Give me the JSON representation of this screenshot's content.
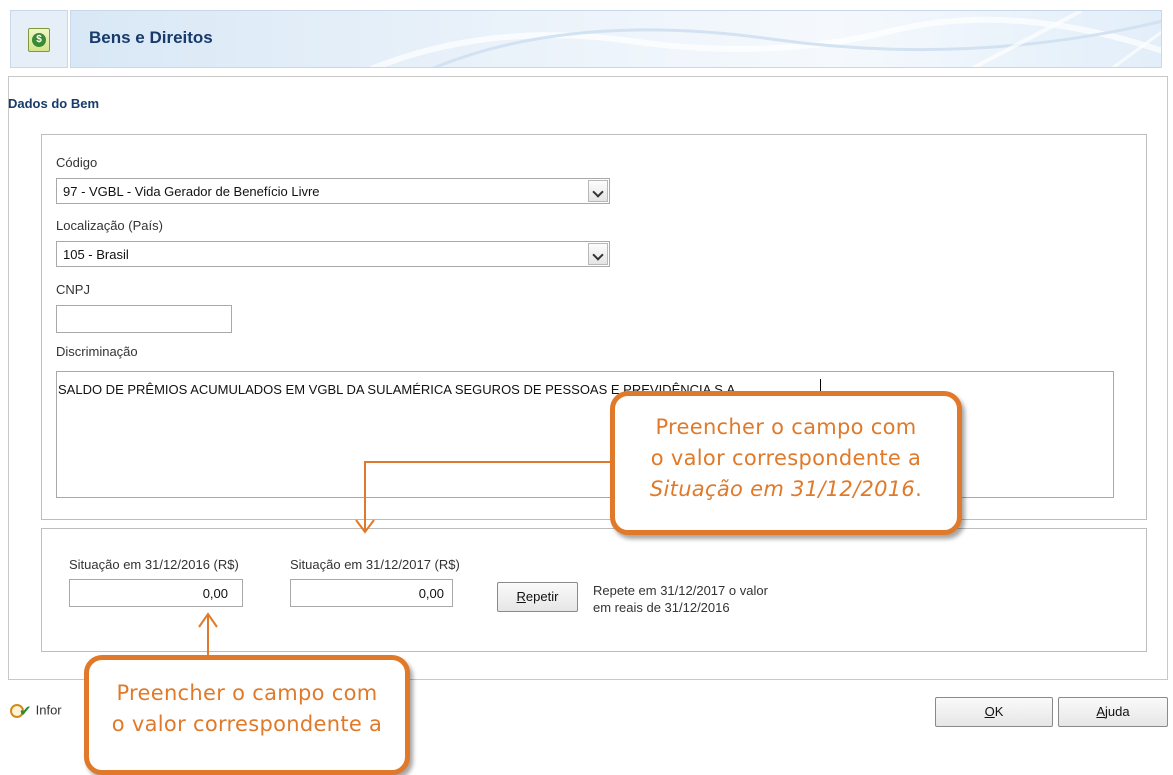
{
  "header": {
    "title": "Bens e Direitos",
    "icon": "money-document-icon"
  },
  "section": {
    "title": "Dados do Bem"
  },
  "form": {
    "codigo": {
      "label": "Código",
      "value": "97 - VGBL - Vida Gerador de Benefício Livre"
    },
    "localizacao": {
      "label": "Localização (País)",
      "value": "105 - Brasil"
    },
    "cnpj": {
      "label": "CNPJ",
      "value": ""
    },
    "discriminacao": {
      "label": "Discriminação",
      "value": "SALDO DE PRÊMIOS ACUMULADOS EM VGBL DA SULAMÉRICA SEGUROS DE PESSOAS E PREVIDÊNCIA S.A."
    },
    "situacao_2016": {
      "label": "Situação em 31/12/2016 (R$)",
      "value": "0,00"
    },
    "situacao_2017": {
      "label": "Situação em 31/12/2017 (R$)",
      "value": "0,00"
    },
    "repetir_button": {
      "label_prefix": "R",
      "label_rest": "epetir"
    },
    "repete_text": {
      "line1": "Repete em 31/12/2017 o valor",
      "line2": "em reais de 31/12/2016"
    }
  },
  "footer": {
    "info_label": "Infor",
    "ok_button": {
      "label_prefix": "O",
      "label_rest": "K"
    },
    "ajuda_button": {
      "label_prefix": "A",
      "label_rest": "juda"
    }
  },
  "callouts": {
    "top": {
      "line1": "Preencher o campo com",
      "line2": "o valor correspondente a",
      "line3": "Situação em 31/12/2016",
      "line3_suffix": "."
    },
    "bottom": {
      "line1": "Preencher o campo com",
      "line2": "o valor correspondente a"
    }
  },
  "colors": {
    "accent": "#e07a2a",
    "title": "#173b6b"
  }
}
